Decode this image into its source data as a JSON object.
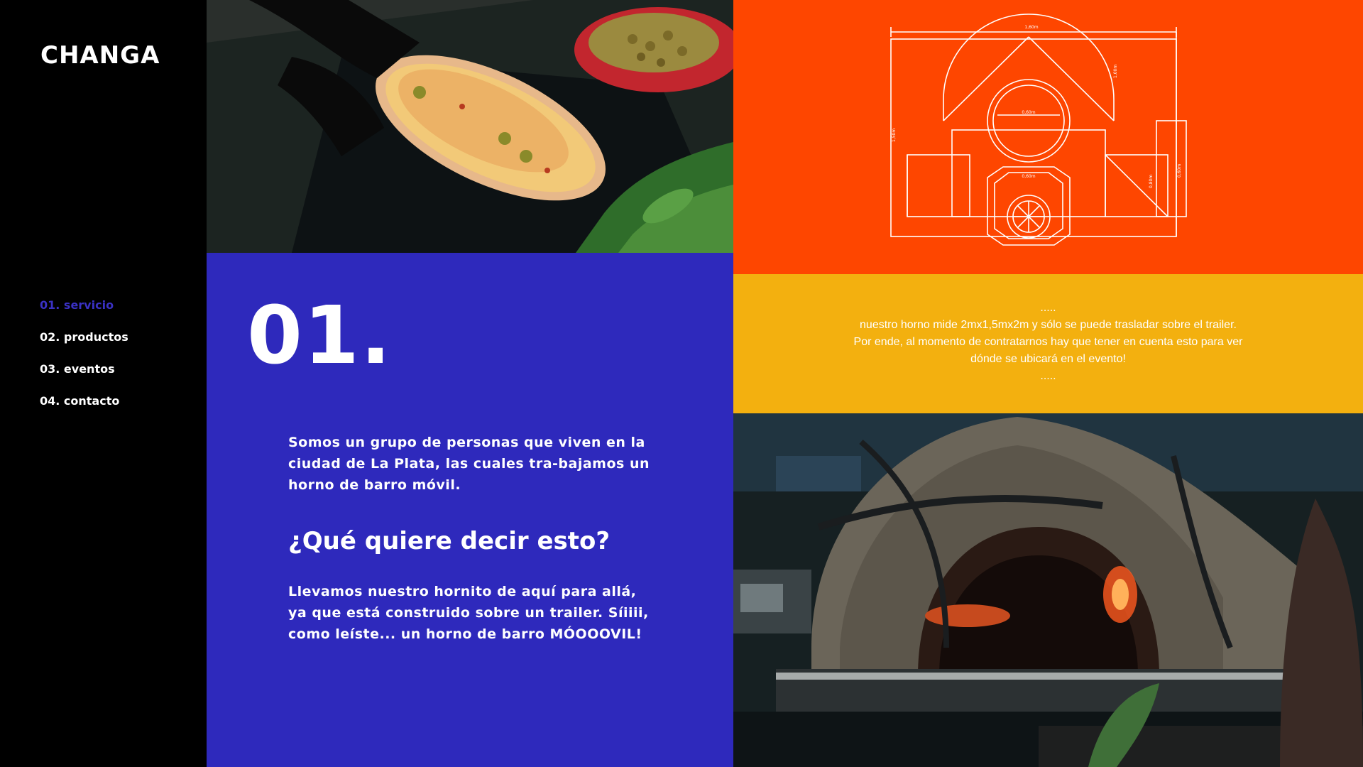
{
  "brand": {
    "logo_text": "CHANGA"
  },
  "nav": {
    "items": [
      {
        "label": "01. servicio",
        "active": true
      },
      {
        "label": "02. productos",
        "active": false
      },
      {
        "label": "03. eventos",
        "active": false
      },
      {
        "label": "04. contacto",
        "active": false
      }
    ]
  },
  "service": {
    "number": "01.",
    "intro": "Somos un grupo de personas que viven en la ciudad de La Plata, las cuales tra-bajamos un horno de barro móvil.",
    "question": "¿Qué quiere decir esto?",
    "detail": "Llevamos nuestro hornito de aquí para allá, ya que está construido sobre un trailer. Síiiii, como leíste... un horno de barro MÓOOOVIL!"
  },
  "note": {
    "dots_top": ".....",
    "line1": "nuestro horno mide 2mx1,5mx2m y sólo se puede trasladar sobre el trailer.",
    "line2": "Por ende, al momento de contratarnos hay que tener en cuenta esto para ver",
    "line3": "dónde se ubicará en el evento!",
    "dots_bottom": "....."
  },
  "blueprint": {
    "dim_width": "1,60m",
    "dim_inner": "0,60m",
    "dim_lower": "0,60m",
    "dim_right": "0,80m",
    "dim_left": "1,50m",
    "dim_side": "0,60m",
    "dim_far": "1,00m"
  },
  "colors": {
    "sidebar": "#000000",
    "blue_panel": "#2e29bc",
    "orange_panel": "#fe4600",
    "yellow_panel": "#f3b00f",
    "active_nav": "#3a31c4"
  }
}
